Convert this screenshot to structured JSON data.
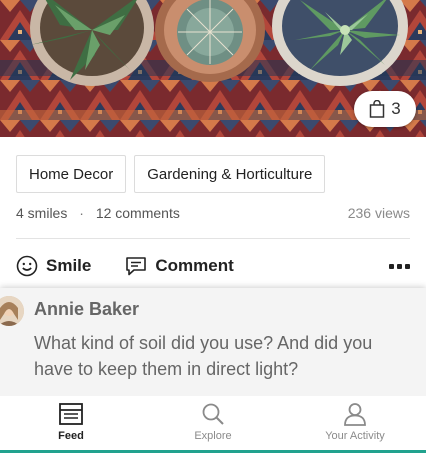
{
  "colors": {
    "accent": "#21a28e",
    "tag_border": "#dcdcdc",
    "comment_bg": "#f4f4f4"
  },
  "hero": {
    "cart_count": "3",
    "cart_icon": "shopping-bag-icon"
  },
  "tags": [
    "Home Decor",
    "Gardening & Horticulture"
  ],
  "stats": {
    "smiles": "4 smiles",
    "separator": "·",
    "comments": "12 comments",
    "views": "236 views"
  },
  "actions": {
    "smile_label": "Smile",
    "comment_label": "Comment",
    "smile_icon": "smile-icon",
    "comment_icon": "comment-icon",
    "more_icon": "more-icon"
  },
  "comment": {
    "author": "Annie Baker",
    "text": "What kind of soil did you use? And did you have to keep them in direct light?"
  },
  "nav": {
    "items": [
      {
        "label": "Feed",
        "icon": "feed-icon",
        "active": true
      },
      {
        "label": "Explore",
        "icon": "search-icon",
        "active": false
      },
      {
        "label": "Your Activity",
        "icon": "person-icon",
        "active": false
      }
    ]
  }
}
